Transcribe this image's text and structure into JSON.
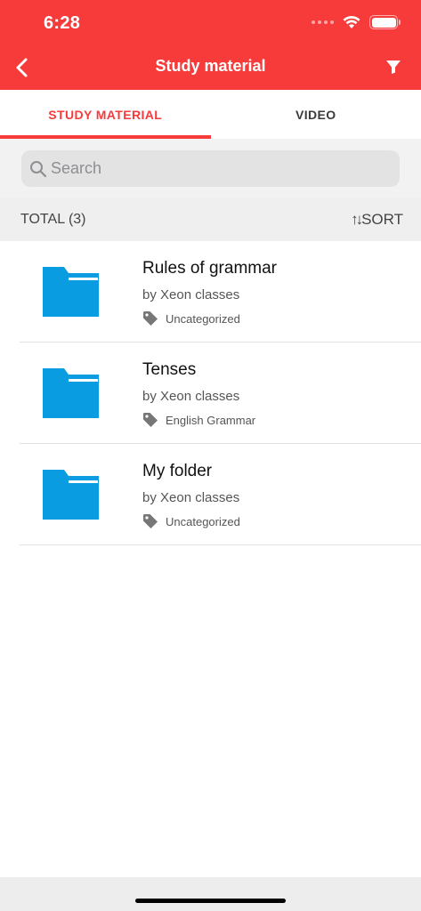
{
  "status_bar": {
    "time": "6:28"
  },
  "nav": {
    "title": "Study material"
  },
  "tabs": [
    {
      "label": "STUDY MATERIAL",
      "active": true
    },
    {
      "label": "VIDEO",
      "active": false
    }
  ],
  "search": {
    "placeholder": "Search",
    "value": ""
  },
  "summary": {
    "total_label": "TOTAL (3)",
    "sort_label": "SORT"
  },
  "items": [
    {
      "title": "Rules of grammar",
      "author": "by Xeon classes",
      "tag": "Uncategorized"
    },
    {
      "title": "Tenses",
      "author": "by Xeon classes",
      "tag": "English Grammar"
    },
    {
      "title": "My folder",
      "author": "by Xeon classes",
      "tag": "Uncategorized"
    }
  ],
  "colors": {
    "accent": "#F73B3B",
    "folder": "#0A9CE0",
    "tag_icon": "#777777"
  },
  "icons": [
    "back-arrow-icon",
    "filter-icon",
    "search-icon",
    "sort-icon",
    "folder-icon",
    "tag-icon",
    "wifi-icon",
    "battery-icon",
    "cellular-icon"
  ]
}
